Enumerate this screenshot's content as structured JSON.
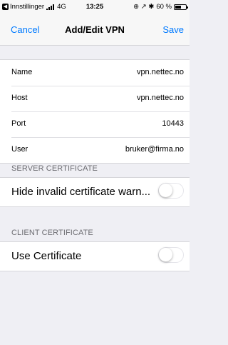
{
  "status_bar": {
    "back_label": "Innstillinger",
    "network": "4G",
    "time": "13:25",
    "right_icons": "⊕ ↗ ✱",
    "battery_text": "60 %",
    "battery_level": 0.6
  },
  "nav": {
    "cancel_label": "Cancel",
    "title": "Add/Edit VPN",
    "save_label": "Save"
  },
  "fields": [
    {
      "label": "Name",
      "value": "vpn.nettec.no"
    },
    {
      "label": "Host",
      "value": "vpn.nettec.no"
    },
    {
      "label": "Port",
      "value": "10443"
    },
    {
      "label": "User",
      "value": "bruker@firma.no"
    }
  ],
  "server_certificate": {
    "header": "SERVER CERTIFICATE",
    "toggle_label": "Hide invalid certificate warn...",
    "toggle_on": false
  },
  "client_certificate": {
    "header": "CLIENT CERTIFICATE",
    "toggle_label": "Use Certificate",
    "toggle_on": false
  },
  "colors": {
    "accent": "#007aff",
    "background": "#efeff4",
    "section_text": "#6d6d72"
  }
}
